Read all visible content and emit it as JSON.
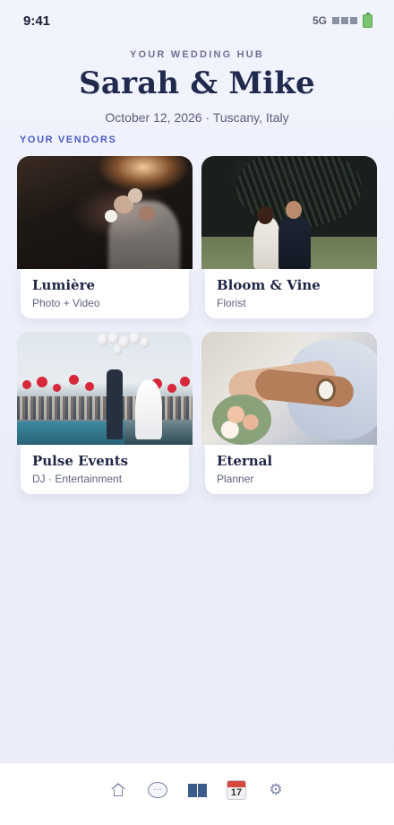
{
  "status_bar": {
    "time": "9:41",
    "network": "5G"
  },
  "header": {
    "eyebrow": "YOUR WEDDING HUB",
    "couple": "Sarah & Mike",
    "details": "October 12, 2026 · Tuscany, Italy"
  },
  "vendors": {
    "section_label": "YOUR VENDORS",
    "items": [
      {
        "name": "Lumière",
        "type": "Photo + Video"
      },
      {
        "name": "Bloom & Vine",
        "type": "Florist"
      },
      {
        "name": "Pulse Events",
        "type": "DJ · Entertainment"
      },
      {
        "name": "Eternal",
        "type": "Planner"
      }
    ]
  },
  "tab_bar": {
    "calendar_day": "17",
    "icons": [
      "home-icon",
      "chat-icon",
      "people-icon",
      "calendar-icon",
      "gear-icon"
    ]
  },
  "colors": {
    "accent": "#4a5cc4",
    "title": "#202a4d",
    "background": "#eef0fa"
  }
}
